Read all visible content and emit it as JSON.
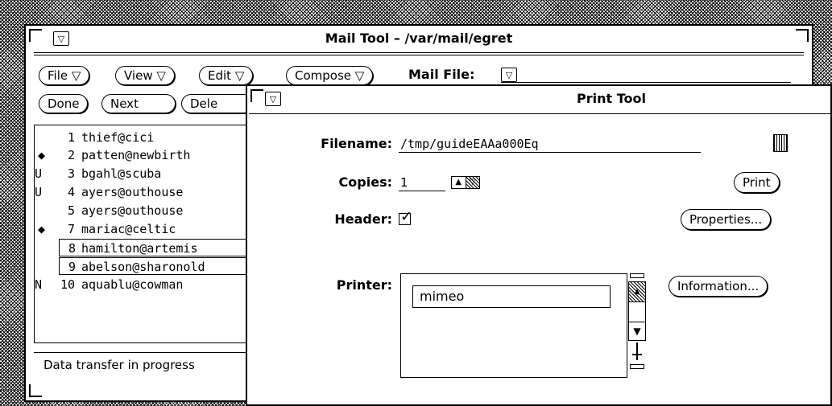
{
  "mail_tool": {
    "title": "Mail Tool  – /var/mail/egret",
    "menu_buttons": {
      "file": "File ▽",
      "view": "View ▽",
      "edit": "Edit ▽",
      "compose": "Compose ▽"
    },
    "mail_file_label": "Mail File:",
    "action_buttons": {
      "done": "Done",
      "next": "Next",
      "delete": "Dele"
    },
    "messages": [
      {
        "status": "",
        "number": "1",
        "from": "thief@cici"
      },
      {
        "status": "◆",
        "number": "2",
        "from": "patten@newbirth"
      },
      {
        "status": "U",
        "number": "3",
        "from": "bgahl@scuba"
      },
      {
        "status": "U",
        "number": "4",
        "from": "ayers@outhouse"
      },
      {
        "status": "",
        "number": "5",
        "from": "ayers@outhouse"
      },
      {
        "status": "◆",
        "number": "7",
        "from": "mariac@celtic"
      },
      {
        "status": "",
        "number": "8",
        "from": "hamilton@artemis"
      },
      {
        "status": "",
        "number": "9",
        "from": "abelson@sharonold"
      },
      {
        "status": "N",
        "number": "10",
        "from": "aquablu@cowman"
      }
    ],
    "status_text": "Data transfer in progress"
  },
  "print_tool": {
    "title": "Print Tool",
    "filename_label": "Filename:",
    "filename_value": "/tmp/guideEAAa000Eq",
    "copies_label": "Copies:",
    "copies_value": "1",
    "header_label": "Header:",
    "header_checked": "✓",
    "printer_label": "Printer:",
    "printer_selected": "mimeo",
    "buttons": {
      "print": "Print",
      "properties": "Properties...",
      "information": "Information..."
    }
  },
  "icons": {
    "menu": "▽",
    "stepper_up": "▲",
    "stepper_down": "▽",
    "scroll_up": "▲",
    "scroll_down": "▼",
    "file_chooser": "file-chooser-icon"
  }
}
